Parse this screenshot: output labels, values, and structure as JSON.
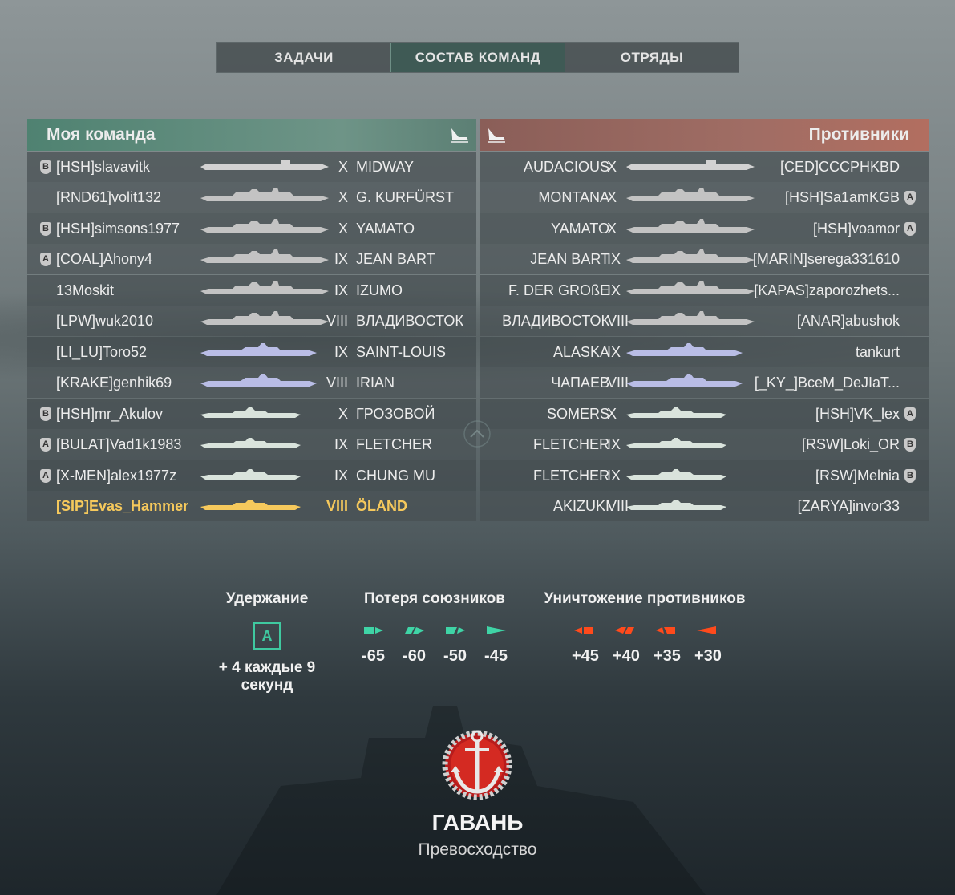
{
  "tabs": [
    {
      "label": "ЗАДАЧИ",
      "active": false
    },
    {
      "label": "СОСТАВ КОМАНД",
      "active": true
    },
    {
      "label": "ОТРЯДЫ",
      "active": false
    }
  ],
  "my_team": {
    "title": "Моя команда",
    "rows": [
      {
        "badge": "B",
        "player": "[HSH]slavavitk",
        "tier": "X",
        "ship": "MIDWAY",
        "class": "cv"
      },
      {
        "badge": "",
        "player": "[RND61]volit132",
        "tier": "X",
        "ship": "G. KURFÜRST",
        "class": "bb"
      },
      {
        "badge": "B",
        "player": "[HSH]simsons1977",
        "tier": "X",
        "ship": "YAMATO",
        "class": "bb"
      },
      {
        "badge": "A",
        "player": "[COAL]Ahony4",
        "tier": "IX",
        "ship": "JEAN BART",
        "class": "bb"
      },
      {
        "badge": "",
        "player": "13Moskit",
        "tier": "IX",
        "ship": "IZUMO",
        "class": "bb"
      },
      {
        "badge": "",
        "player": "[LPW]wuk2010",
        "tier": "VIII",
        "ship": "ВЛАДИВОСТОК",
        "class": "bb"
      },
      {
        "badge": "",
        "player": "[LI_LU]Toro52",
        "tier": "IX",
        "ship": "SAINT-LOUIS",
        "class": "ca"
      },
      {
        "badge": "",
        "player": "[KRAKE]genhik69",
        "tier": "VIII",
        "ship": "IRIAN",
        "class": "ca"
      },
      {
        "badge": "B",
        "player": "[HSH]mr_Akulov",
        "tier": "X",
        "ship": "ГРОЗОВОЙ",
        "class": "dd"
      },
      {
        "badge": "A",
        "player": "[BULAT]Vad1k1983",
        "tier": "IX",
        "ship": "FLETCHER",
        "class": "dd"
      },
      {
        "badge": "A",
        "player": "[X-MEN]alex1977z",
        "tier": "IX",
        "ship": "CHUNG MU",
        "class": "dd"
      },
      {
        "badge": "",
        "player": "[SIP]Evas_Hammer",
        "tier": "VIII",
        "ship": "ÖLAND",
        "class": "me"
      }
    ]
  },
  "enemy_team": {
    "title": "Противники",
    "rows": [
      {
        "ship": "AUDACIOUS",
        "tier": "X",
        "player": "[CED]CCCPHKBD",
        "badge": "",
        "class": "cv"
      },
      {
        "ship": "MONTANA",
        "tier": "X",
        "player": "[HSH]Sa1amKGB",
        "badge": "A",
        "class": "bb"
      },
      {
        "ship": "YAMATO",
        "tier": "X",
        "player": "[HSH]voamor",
        "badge": "A",
        "class": "bb"
      },
      {
        "ship": "JEAN BART",
        "tier": "IX",
        "player": "[MARIN]serega331610",
        "badge": "",
        "class": "bb"
      },
      {
        "ship": "F. DER GROßE",
        "tier": "IX",
        "player": "[KAPAS]zaporozhets...",
        "badge": "",
        "class": "bb"
      },
      {
        "ship": "ВЛАДИВОСТОК",
        "tier": "VIII",
        "player": "[ANAR]abushok",
        "badge": "",
        "class": "bb"
      },
      {
        "ship": "ALASKA",
        "tier": "IX",
        "player": "tankurt",
        "badge": "",
        "class": "ca"
      },
      {
        "ship": "ЧАПАЕВ",
        "tier": "VIII",
        "player": "[_KY_]BceM_DeJIaT...",
        "badge": "",
        "class": "ca"
      },
      {
        "ship": "SOMERS",
        "tier": "X",
        "player": "[HSH]VK_lex",
        "badge": "A",
        "class": "dd"
      },
      {
        "ship": "FLETCHER",
        "tier": "IX",
        "player": "[RSW]Loki_OR",
        "badge": "B",
        "class": "dd"
      },
      {
        "ship": "FLETCHER",
        "tier": "IX",
        "player": "[RSW]Melnia",
        "badge": "B",
        "class": "dd"
      },
      {
        "ship": "AKIZUKI",
        "tier": "VIII",
        "player": "[ZARYA]invor33",
        "badge": "",
        "class": "dd"
      }
    ]
  },
  "scoring": {
    "hold": {
      "title": "Удержание",
      "cap_letter": "A",
      "text_line1": "+ 4 каждые 9",
      "text_line2": "секунд"
    },
    "ally_loss": {
      "title": "Потеря союзников",
      "values": [
        "-65",
        "-60",
        "-50",
        "-45"
      ],
      "color": "#3fd4a6"
    },
    "enemy_kill": {
      "title": "Уничтожение противников",
      "values": [
        "+45",
        "+40",
        "+35",
        "+30"
      ],
      "color": "#ff4a1c"
    }
  },
  "mode": {
    "map": "ГАВАНЬ",
    "type": "Превосходство"
  },
  "colors": {
    "cv": "#d2d2d2",
    "bb": "#c3c3c3",
    "ca": "#b9bde6",
    "dd": "#d9e3dc",
    "me": "#f6c95c"
  }
}
